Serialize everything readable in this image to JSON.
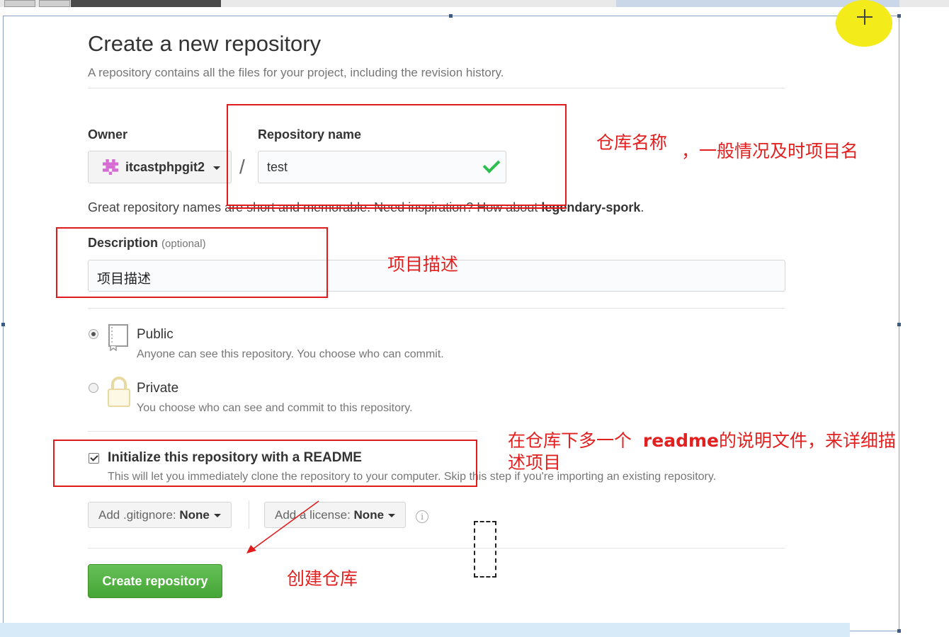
{
  "page": {
    "title": "Create a new repository",
    "subtitle": "A repository contains all the files for your project, including the revision history."
  },
  "owner": {
    "label": "Owner",
    "value": "itcastphpgit2"
  },
  "repository_name": {
    "label": "Repository name",
    "value": "test",
    "status_icon": "check-icon"
  },
  "name_hint": {
    "prefix": "Great repository names are short and memorable. Need inspiration? How about ",
    "suggestion": "legendary-spork",
    "suffix": "."
  },
  "description": {
    "label": "Description",
    "optional": "(optional)",
    "value": "项目描述"
  },
  "visibility": {
    "public": {
      "title": "Public",
      "desc": "Anyone can see this repository. You choose who can commit.",
      "selected": true,
      "icon": "repo-icon"
    },
    "private": {
      "title": "Private",
      "desc": "You choose who can see and commit to this repository.",
      "selected": false,
      "icon": "lock-icon"
    }
  },
  "readme": {
    "title": "Initialize this repository with a README",
    "desc": "This will let you immediately clone the repository to your computer. Skip this step if you're importing an existing repository.",
    "checked": true
  },
  "gitignore": {
    "label": "Add .gitignore:",
    "value": "None"
  },
  "license": {
    "label": "Add a license:",
    "value": "None"
  },
  "submit": {
    "label": "Create repository"
  },
  "annotations": {
    "repo_name_note_a": "仓库名称",
    "repo_name_note_b": "，一般情况及时项目名",
    "description_note": "项目描述",
    "readme_note_a": "在仓库下多一个",
    "readme_note_b": "readme",
    "readme_note_c": "的说明文件，来详细描",
    "readme_note_d": "述项目",
    "create_note": "创建仓库"
  },
  "colors": {
    "annotation_red": "#e01b1b",
    "button_green": "#55b246",
    "check_green": "#2cbe4e",
    "highlight_yellow": "#f4ec1a"
  }
}
